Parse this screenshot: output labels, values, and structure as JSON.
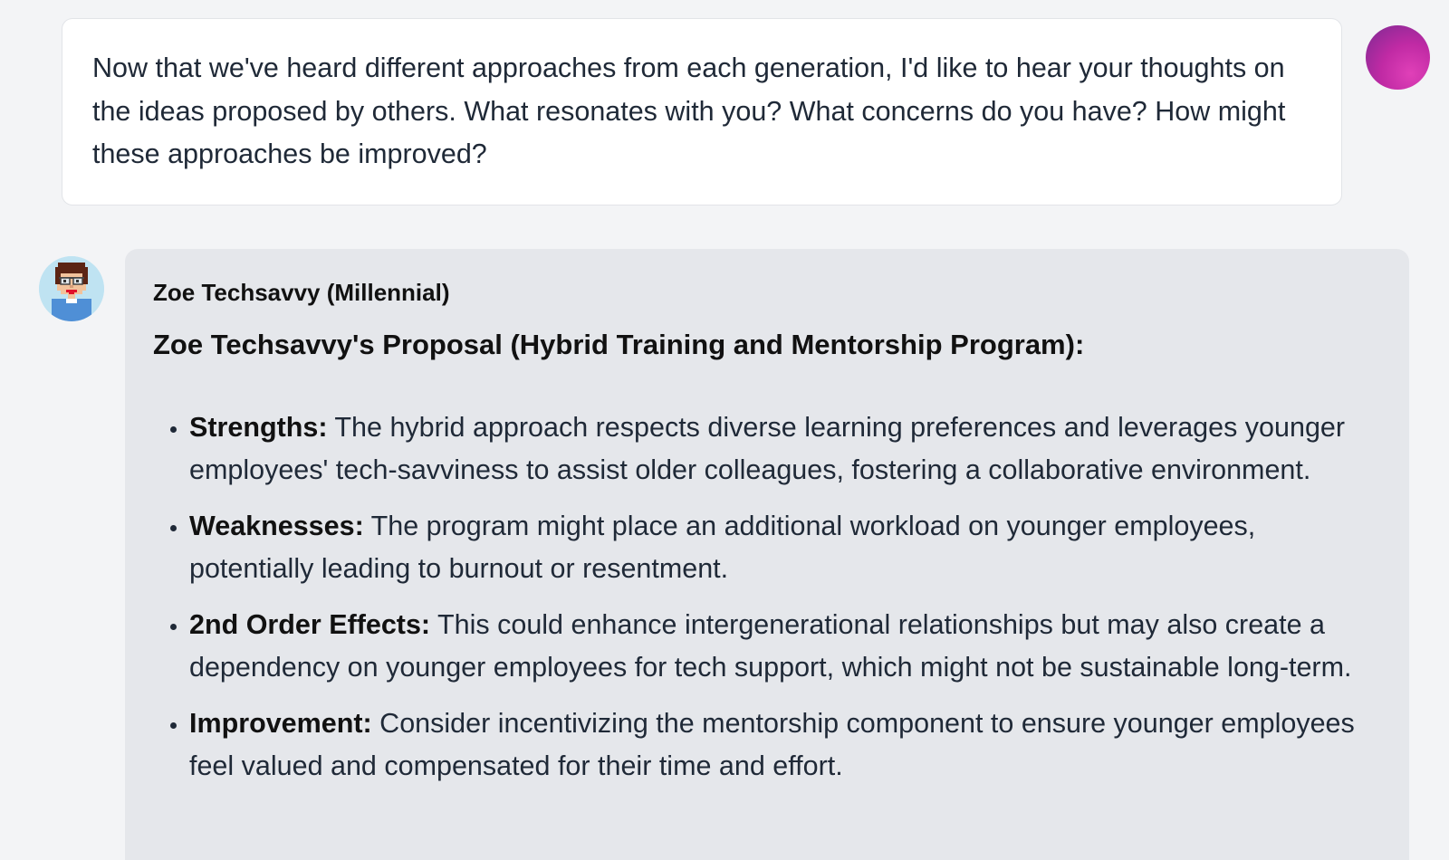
{
  "user_message": {
    "text": "Now that we've heard different approaches from each generation, I'd like to hear your thoughts on the ideas proposed by others. What resonates with you? What concerns do you have? How might these approaches be improved?"
  },
  "assistant_message": {
    "speaker": "Zoe Techsavvy (Millennial)",
    "proposal_title": "Zoe Techsavvy's Proposal (Hybrid Training and Mentorship Program):",
    "points": [
      {
        "label": "Strengths:",
        "text": " The hybrid approach respects diverse learning preferences and leverages younger employees' tech-savviness to assist older colleagues, fostering a collaborative environment."
      },
      {
        "label": "Weaknesses:",
        "text": " The program might place an additional workload on younger employees, potentially leading to burnout or resentment."
      },
      {
        "label": "2nd Order Effects:",
        "text": " This could enhance intergenerational relationships but may also create a dependency on younger employees for tech support, which might not be sustainable long-term."
      },
      {
        "label": "Improvement:",
        "text": " Consider incentivizing the mentorship component to ensure younger employees feel valued and compensated for their time and effort."
      }
    ]
  },
  "icons": {
    "user_avatar": "user-avatar-gradient",
    "bot_avatar": "pixel-character-with-glasses"
  },
  "colors": {
    "page_background": "#f3f4f6",
    "user_bubble": "#ffffff",
    "assistant_bubble": "#e5e7eb",
    "user_avatar_accent": "#c02aa4"
  }
}
